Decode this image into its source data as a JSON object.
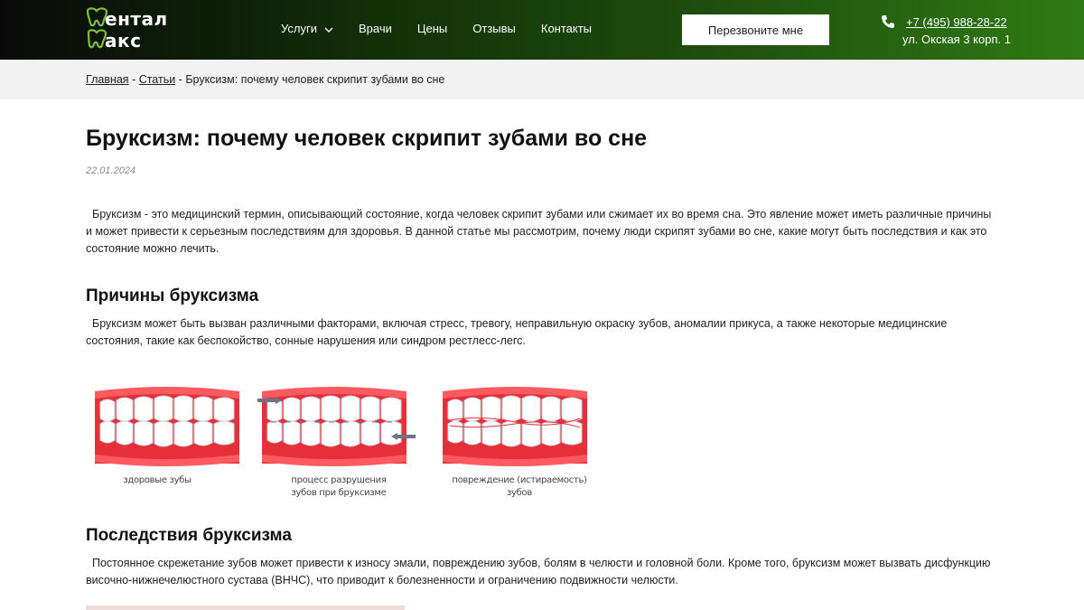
{
  "header": {
    "logo_line1": "ентал",
    "logo_line2": "акс",
    "nav": [
      {
        "label": "Услуги",
        "has_dropdown": true
      },
      {
        "label": "Врачи"
      },
      {
        "label": "Цены"
      },
      {
        "label": "Отзывы"
      },
      {
        "label": "Контакты"
      }
    ],
    "callback_label": "Перезвоните мне",
    "phone": "+7 (495) 988-28-22",
    "address": "ул. Окская 3 корп. 1"
  },
  "breadcrumb": {
    "home": "Главная",
    "sep1": " - ",
    "articles": "Статьи",
    "sep2": " - ",
    "current": "Бруксизм: почему человек скрипит зубами во сне"
  },
  "article": {
    "title": "Бруксизм: почему человек скрипит зубами во сне",
    "date": "22.01.2024",
    "intro": "Бруксизм - это медицинский термин, описывающий состояние, когда человек скрипит зубами или сжимает их во время сна. Это явление может иметь различные причины и может привести к серьезным последствиям для здоровья. В данной статье мы рассмотрим, почему люди скрипят зубами во сне, какие могут быть последствия и как это состояние можно лечить.",
    "h_causes": "Причины бруксизма",
    "causes_text": "Бруксизм может быть вызван различными факторами, включая стресс, тревогу, неправильную окраску зубов, аномалии прикуса, а также некоторые медицинские состояния, такие как беспокойство, сонные нарушения или синдром рестлесс-легс.",
    "illustration_captions": {
      "healthy": "здоровые зубы",
      "process_line1": "процесс разрушения",
      "process_line2": "зубов при бруксизме",
      "damage": "повреждение (истираемость) зубов"
    },
    "h_consequences": "Последствия бруксизма",
    "consequences_text": "Постоянное скрежетание зубов может привести к износу эмали, повреждению зубов, болям в челюсти и головной боли. Кроме того, бруксизм может вызвать дисфункцию височно-нижнечелюстного сустава (ВНЧС), что приводит к болезненности и ограничению подвижности челюсти."
  },
  "colors": {
    "header_start": "#0a0a0a",
    "header_end": "#2f7a14",
    "logo_green": "#7ac142",
    "gum_red": "#e5303a"
  }
}
